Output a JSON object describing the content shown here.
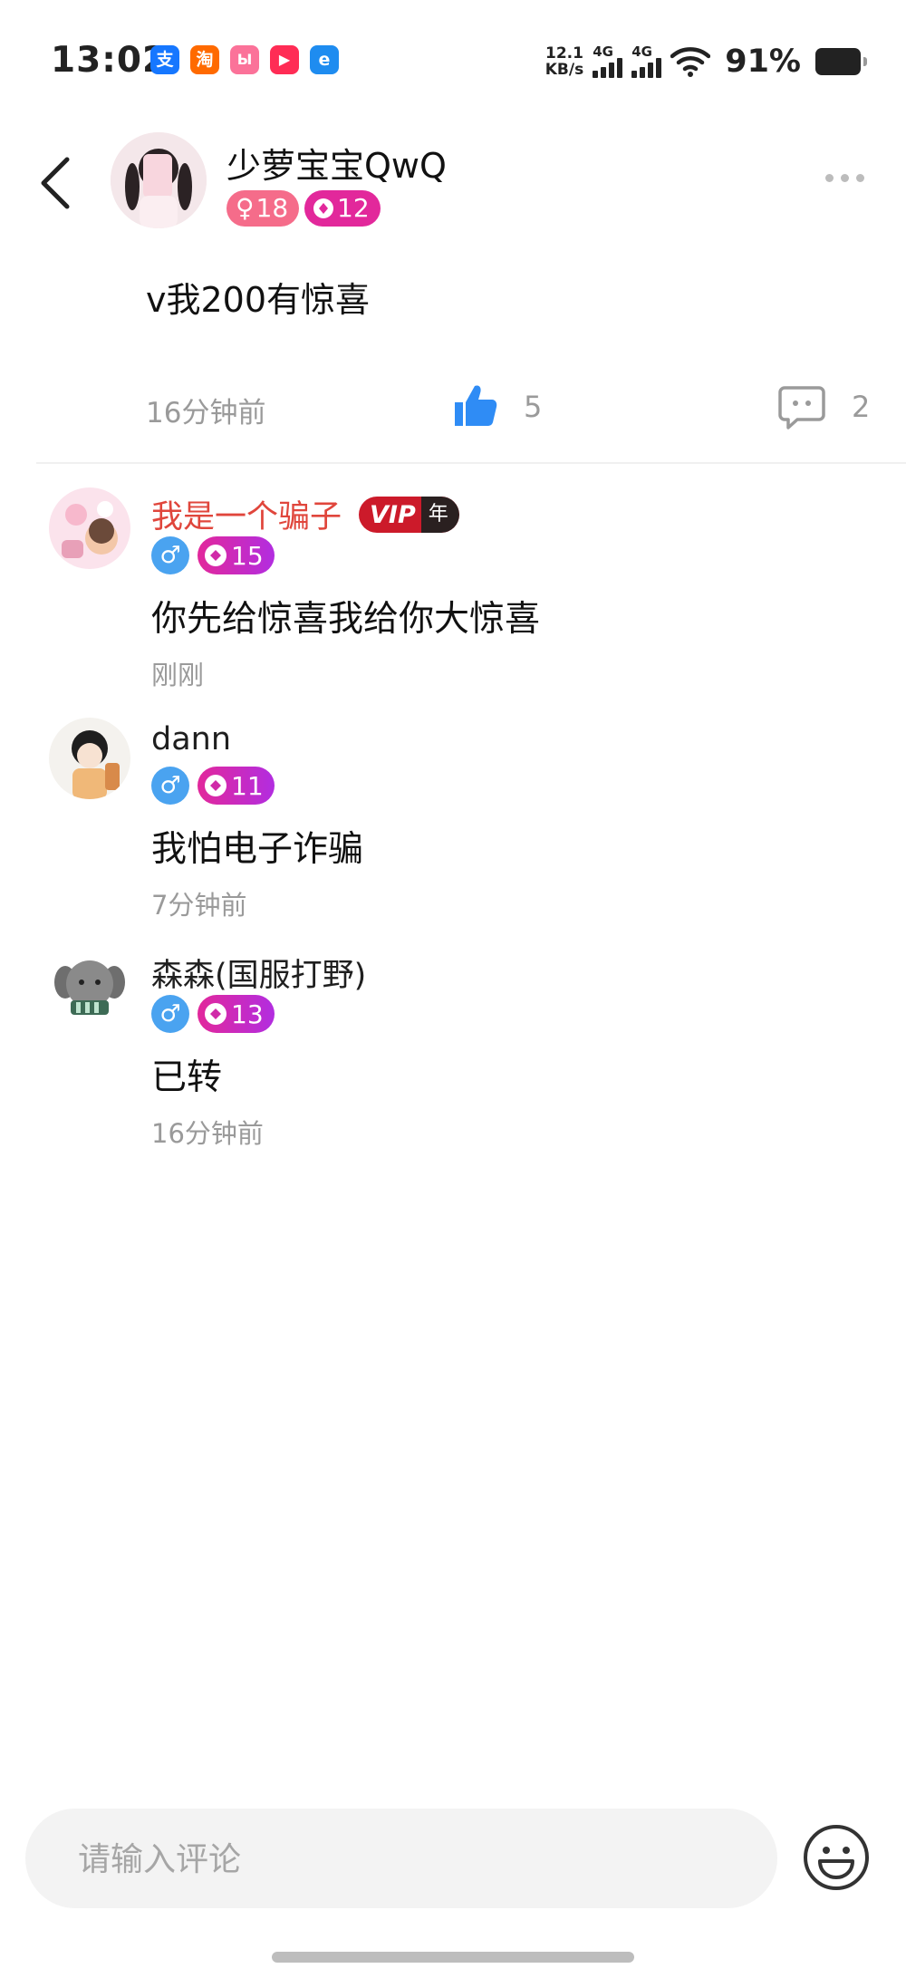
{
  "status_bar": {
    "time": "13:02",
    "apps": [
      {
        "icon": "alipay-icon",
        "glyph": "支",
        "color": "#1677ff"
      },
      {
        "icon": "taobao-icon",
        "glyph": "淘",
        "color": "#ff6a00"
      },
      {
        "icon": "bilibili-icon",
        "glyph": "Ы",
        "color": "#fb7299"
      },
      {
        "icon": "video-app-icon",
        "glyph": "▶",
        "color": "#ff2c55"
      },
      {
        "icon": "browser-icon",
        "glyph": "e",
        "color": "#1e8cf0"
      }
    ],
    "net_speed_top": "12.1",
    "net_speed_unit": "KB/s",
    "signal1_label": "4G",
    "signal2_label": "4G",
    "battery": "91%"
  },
  "post": {
    "author": "少萝宝宝QwQ",
    "gender_symbol": "♀",
    "age": "18",
    "level": "12",
    "content": "v我200有惊喜",
    "time": "16分钟前",
    "likes": "5",
    "comments": "2"
  },
  "comments": [
    {
      "name": "我是一个骗子",
      "vip": true,
      "vip_label": "VIP",
      "vip_tag": "年",
      "gender_symbol": "♂",
      "level": "15",
      "text": "你先给惊喜我给你大惊喜",
      "time": "刚刚"
    },
    {
      "name": "dann",
      "vip": false,
      "gender_symbol": "♂",
      "level": "11",
      "text": "我怕电子诈骗",
      "time": "7分钟前"
    },
    {
      "name": "森森(国服打野)",
      "vip": false,
      "gender_symbol": "♂",
      "level": "13",
      "text": "已转",
      "time": "16分钟前"
    }
  ],
  "input": {
    "placeholder": "请输入评论"
  },
  "colors": {
    "female_badge": "#f56c8a",
    "level_badge": "#e2289b",
    "male_badge": "#4aa3f0",
    "vip_red": "#cc1a2a",
    "like_blue": "#2f8cf5"
  }
}
